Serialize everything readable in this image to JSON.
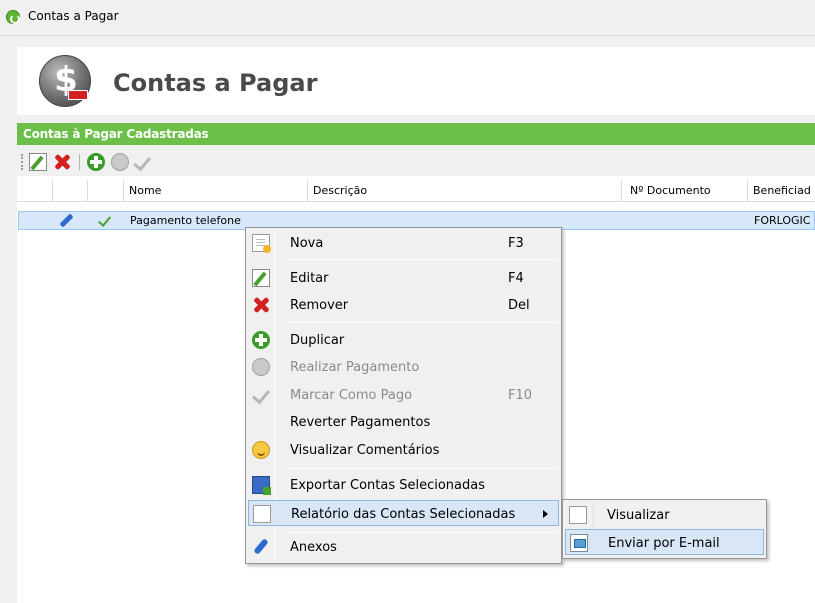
{
  "window": {
    "title": "Contas a Pagar"
  },
  "header": {
    "title": "Contas a Pagar"
  },
  "section": {
    "title": "Contas à Pagar Cadastradas"
  },
  "toolbar": {
    "icons": [
      "edit-icon",
      "remove-icon",
      "duplicate-icon",
      "pay-icon",
      "mark-paid-icon"
    ]
  },
  "grid": {
    "columns": [
      "Nome",
      "Descrição",
      "Nº Documento",
      "Beneficiad"
    ],
    "rows": [
      {
        "nome": "Pagamento telefone",
        "descricao": "",
        "documento": "",
        "beneficiario": "FORLOGIC"
      }
    ]
  },
  "context_menu": {
    "items": [
      {
        "label": "Nova",
        "shortcut": "F3",
        "icon": "new-document-icon",
        "enabled": true
      },
      {
        "label": "Editar",
        "shortcut": "F4",
        "icon": "edit-icon",
        "enabled": true
      },
      {
        "label": "Remover",
        "shortcut": "Del",
        "icon": "remove-icon",
        "enabled": true
      },
      {
        "label": "Duplicar",
        "shortcut": "",
        "icon": "duplicate-icon",
        "enabled": true
      },
      {
        "label": "Realizar Pagamento",
        "shortcut": "",
        "icon": "coin-icon",
        "enabled": false
      },
      {
        "label": "Marcar Como Pago",
        "shortcut": "F10",
        "icon": "check-icon",
        "enabled": false
      },
      {
        "label": "Reverter Pagamentos",
        "shortcut": "",
        "icon": "",
        "enabled": true
      },
      {
        "label": "Visualizar Comentários",
        "shortcut": "",
        "icon": "comments-icon",
        "enabled": true
      },
      {
        "label": "Exportar Contas Selecionadas",
        "shortcut": "",
        "icon": "export-icon",
        "enabled": true
      },
      {
        "label": "Relatório das Contas Selecionadas",
        "shortcut": "",
        "icon": "report-icon",
        "enabled": true
      },
      {
        "label": "Anexos",
        "shortcut": "",
        "icon": "attachment-icon",
        "enabled": true
      }
    ]
  },
  "submenu": {
    "items": [
      {
        "label": "Visualizar",
        "icon": "report-icon"
      },
      {
        "label": "Enviar por E-mail",
        "icon": "email-icon"
      }
    ]
  },
  "colors": {
    "section_bar": "#6cc04a",
    "selection": "#d6e8fa",
    "menu_highlight": "#d8e6f6"
  }
}
